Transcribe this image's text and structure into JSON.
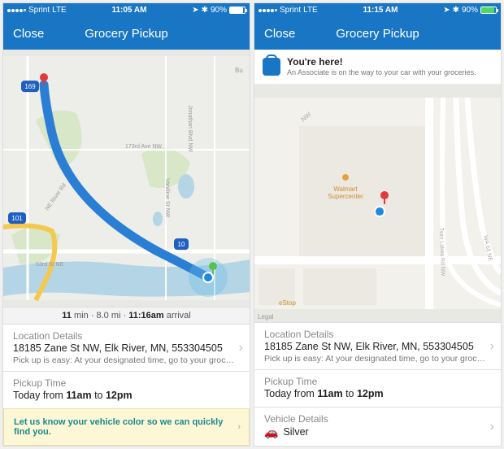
{
  "left": {
    "status": {
      "carrier": "Sprint",
      "net": "LTE",
      "time": "11:05 AM",
      "battery_pct": "90%"
    },
    "nav": {
      "close": "Close",
      "title": "Grocery Pickup"
    },
    "eta": {
      "min": "11",
      "min_label": "min",
      "dist": "8.0 mi",
      "arrival": "11:16am",
      "arrival_label": "arrival"
    },
    "location": {
      "label": "Location Details",
      "address": "18185 Zane St NW, Elk River, MN, 553304505",
      "sub": "Pick up is easy: At your designated time, go to your groc…"
    },
    "pickup": {
      "label": "Pickup Time",
      "prefix": "Today from ",
      "from": "11am",
      "to_word": " to ",
      "to": "12pm"
    },
    "vehicle_prompt": "Let us know your vehicle color so we can quickly find you.",
    "map": {
      "labels": {
        "road1": "53rd St NE",
        "road2": "NE River Rd",
        "road3": "173rd Ave NW",
        "road4": "Jonathan Blvd NW",
        "road5": "Vanilline St NW",
        "road6": "Bu"
      },
      "hw": {
        "a": "169",
        "b": "101",
        "c": "10"
      }
    }
  },
  "right": {
    "status": {
      "carrier": "Sprint",
      "net": "LTE",
      "time": "11:15 AM",
      "battery_pct": "90%"
    },
    "nav": {
      "close": "Close",
      "title": "Grocery Pickup"
    },
    "notice": {
      "title": "You're here!",
      "sub": "An Associate is on the way to your car with your groceries."
    },
    "location": {
      "label": "Location Details",
      "address": "18185 Zane St NW, Elk River, MN, 553304505",
      "sub": "Pick up is easy: At your designated time, go to your groc…"
    },
    "pickup": {
      "label": "Pickup Time",
      "prefix": "Today from ",
      "from": "11am",
      "to_word": " to ",
      "to": "12pm"
    },
    "vehicle": {
      "label": "Vehicle Details",
      "color": "Silver"
    },
    "map": {
      "poi": "Walmart\nSupercenter",
      "poi2": "eStop",
      "label_nw": "NW",
      "road": "Twin Lakes Rd NW",
      "road2": "WA 65 NE",
      "legal": "Legal"
    }
  }
}
